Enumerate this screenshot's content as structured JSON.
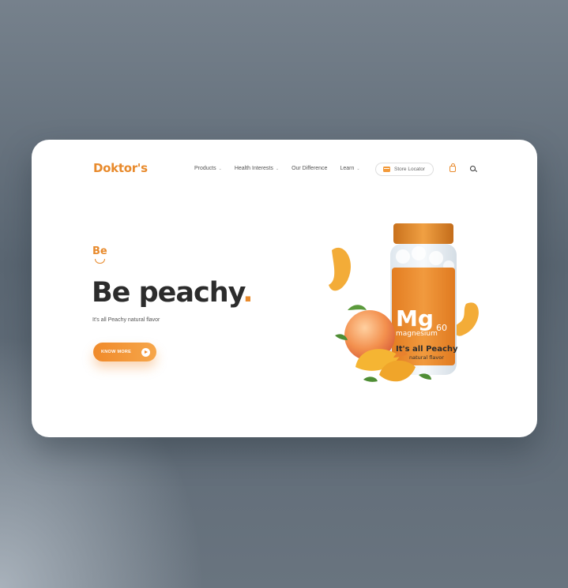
{
  "brand": {
    "logo": "Doktor's",
    "accent": "#e88a2c"
  },
  "nav": {
    "items": [
      {
        "label": "Products",
        "has_dropdown": true
      },
      {
        "label": "Health Interests",
        "has_dropdown": true
      },
      {
        "label": "Our Difference",
        "has_dropdown": false
      },
      {
        "label": "Learn",
        "has_dropdown": true
      }
    ],
    "store_locator": "Store Locator",
    "dropdown_glyph": "⌄",
    "icons": {
      "store": "store-icon",
      "cart": "shopping-bag-icon",
      "search": "search-icon"
    }
  },
  "hero": {
    "mark": "Be",
    "headline": "Be peachy",
    "headline_dot": ".",
    "subline": "It's all Peachy natural flavor",
    "cta_label": "KNOW MORE"
  },
  "product": {
    "symbol": "Mg",
    "name": "magnesium",
    "count": "60",
    "tagline": "It's all Peachy",
    "flavor": "natural flavor",
    "cap_color": "#e8912e",
    "label_color": "#ee8f2f"
  }
}
